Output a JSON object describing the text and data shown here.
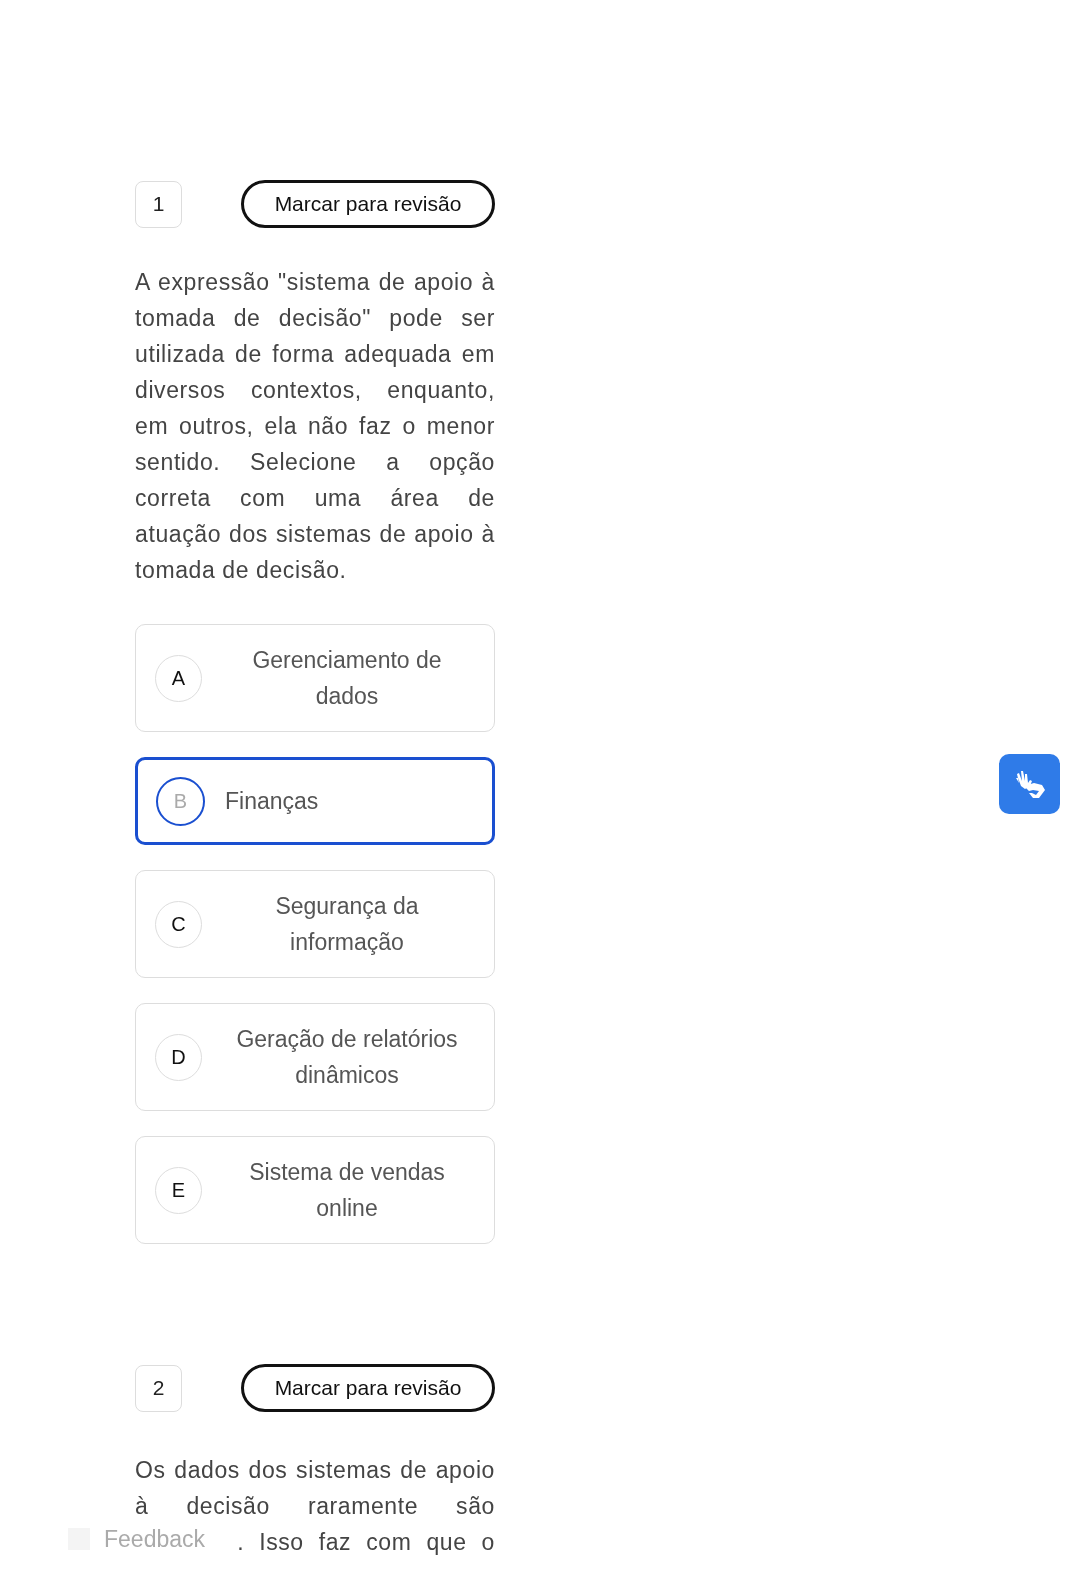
{
  "questions": [
    {
      "number": "1",
      "review_button": "Marcar para revisão",
      "text": [
        "A expressão \"sistema de apoio à tomada de decisão\" pode ser utilizada de forma adequada em diversos contextos, enquanto, em outros, ela não faz o menor sentido. Selecione a opção correta com uma área de atuação dos sistemas de apoio à tomada de decisão."
      ],
      "options": [
        {
          "letter": "A",
          "text": "Gerenciamento de dados",
          "selected": false
        },
        {
          "letter": "B",
          "text": "Finanças",
          "selected": true
        },
        {
          "letter": "C",
          "text": "Segurança da informação",
          "selected": false
        },
        {
          "letter": "D",
          "text": "Geração de relatórios dinâmicos",
          "selected": false
        },
        {
          "letter": "E",
          "text": "Sistema de vendas online",
          "selected": false
        }
      ]
    },
    {
      "number": "2",
      "review_button": "Marcar para revisão",
      "text": [
        "Os dados dos sistemas de apoio à decisão raramente são",
        ". Isso faz com que o"
      ]
    }
  ],
  "feedback_button": "Feedback"
}
